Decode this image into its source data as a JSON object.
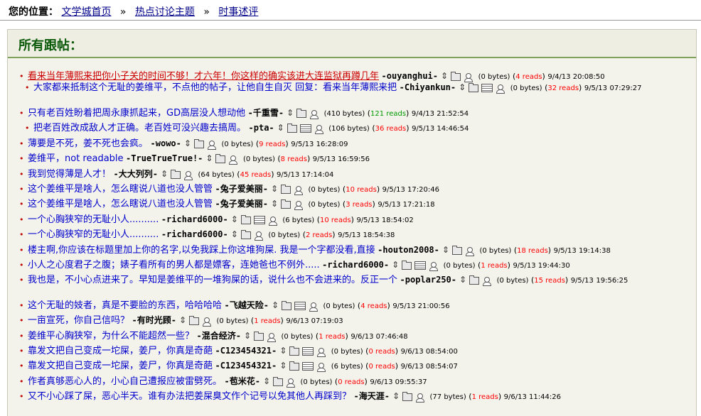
{
  "breadcrumb": {
    "label": "您的位置：",
    "links": [
      "文学城首页",
      "热点讨论主题",
      "时事述评"
    ],
    "sep": "»"
  },
  "panel": {
    "title": "所有跟帖："
  },
  "posts": [
    {
      "indent": 0,
      "title": "看来当年薄熙来把你小子关的时间不够！才六年！你这样的确实该进大连监狱再蹲几年",
      "author": "-ouyanghui-",
      "doc": false,
      "size": "(0 bytes)",
      "reads": "4 reads",
      "readsColor": "#ff0000",
      "date": "9/4/13 20:08:50",
      "red": true
    },
    {
      "indent": 1,
      "title": "大家都来抵制这个无耻的姜维平，不点他的帖子，让他自生自灭 回复：看来当年薄熙来把",
      "author": "-Chiyankun-",
      "doc": true,
      "size": "(0 bytes)",
      "reads": "32 reads",
      "readsColor": "#ff0000",
      "date": "9/5/13",
      "date2": "07:29:27",
      "red": false
    },
    {
      "indent": 0,
      "title": "只有老百姓盼着把周永康抓起来，GD高层没人想动他",
      "author": "-千重雪-",
      "doc": false,
      "size": "(410 bytes)",
      "reads": "121 reads",
      "readsColor": "#009900",
      "date": "9/4/13 21:52:54",
      "red": false
    },
    {
      "indent": 1,
      "title": "把老百姓改成敌人才正确。老百姓可没兴趣去搞周。",
      "author": "-pta-",
      "doc": true,
      "size": "(106 bytes)",
      "reads": "36 reads",
      "readsColor": "#ff0000",
      "date": "9/5/13 14:46:54",
      "red": false
    },
    {
      "indent": 0,
      "title": "薄要是不死，姜不死也会疯。",
      "author": "-wowo-",
      "doc": false,
      "size": "(0 bytes)",
      "reads": "9 reads",
      "readsColor": "#ff0000",
      "date": "9/5/13 16:28:09",
      "red": false
    },
    {
      "indent": 0,
      "title": "姜维平，not readable",
      "author": "-TrueTrueTrue!-",
      "doc": false,
      "size": "(0 bytes)",
      "reads": "8 reads",
      "readsColor": "#ff0000",
      "date": "9/5/13 16:59:56",
      "red": false
    },
    {
      "indent": 0,
      "title": "我到觉得薄是人才！",
      "author": "-大大列列-",
      "doc": false,
      "size": "(64 bytes)",
      "reads": "45 reads",
      "readsColor": "#ff0000",
      "date": "9/5/13 17:14:04",
      "red": false
    },
    {
      "indent": 0,
      "title": "这个姜维平是啥人，怎么瞎说八道也没人管管",
      "author": "-兔子爱美丽-",
      "doc": false,
      "size": "(0 bytes)",
      "reads": "10 reads",
      "readsColor": "#ff0000",
      "date": "9/5/13 17:20:46",
      "red": false
    },
    {
      "indent": 0,
      "title": "这个姜维平是啥人，怎么瞎说八道也没人管管",
      "author": "-兔子爱美丽-",
      "doc": false,
      "size": "(0 bytes)",
      "reads": "3 reads",
      "readsColor": "#ff0000",
      "date": "9/5/13 17:21:18",
      "red": false
    },
    {
      "indent": 0,
      "title": "一个心胸狭窄的无耻小人..........",
      "author": "-richard6000-",
      "doc": true,
      "size": "(6 bytes)",
      "reads": "10 reads",
      "readsColor": "#ff0000",
      "date": "9/5/13 18:54:02",
      "red": false
    },
    {
      "indent": 0,
      "title": "一个心胸狭窄的无耻小人..........",
      "author": "-richard6000-",
      "doc": false,
      "size": "(0 bytes)",
      "reads": "2 reads",
      "readsColor": "#ff0000",
      "date": "9/5/13 18:54:38",
      "red": false
    },
    {
      "indent": 0,
      "title": "楼主啊,你应该在标题里加上你的名字,以免我踩上你这堆狗屎. 我是一个字都没看,直接",
      "author": "-houton2008-",
      "doc": false,
      "size": "(0 bytes)",
      "reads": "18 reads",
      "readsColor": "#ff0000",
      "date": "9/5/13 19:14:38",
      "red": false
    },
    {
      "indent": 0,
      "title": "小人之心度君子之腹；婊子看所有的男人都是嫖客，连她爸也不例外.....",
      "author": "-richard6000-",
      "doc": true,
      "size": "(0 bytes)",
      "reads": "1 reads",
      "readsColor": "#ff0000",
      "date": "9/5/13 19:44:30",
      "red": false
    },
    {
      "indent": 0,
      "title": "我也是，不小心点进来了。早知是姜维平的一堆狗屎的话，说什么也不会进来的。反正一个",
      "author": "-poplar250-",
      "doc": false,
      "size": "(0 bytes)",
      "reads": "15 reads",
      "readsColor": "#ff0000",
      "date": "9/5/13",
      "date2": "19:56:25",
      "red": false
    },
    {
      "indent": 0,
      "title": "这个无耻的妓者，真是不要脸的东西，哈哈哈哈",
      "author": "-飞越天险-",
      "doc": true,
      "size": "(0 bytes)",
      "reads": "4 reads",
      "readsColor": "#ff0000",
      "date": "9/5/13 21:00:56",
      "red": false
    },
    {
      "indent": 0,
      "title": "一亩宣死，你自己信吗？",
      "author": "-有时光顾-",
      "doc": false,
      "size": "(0 bytes)",
      "reads": "1 reads",
      "readsColor": "#ff0000",
      "date": "9/6/13 07:19:03",
      "red": false
    },
    {
      "indent": 0,
      "title": "姜维平心胸狭窄，为什么不能超然一些？",
      "author": "-混合经济-",
      "doc": false,
      "size": "(0 bytes)",
      "reads": "1 reads",
      "readsColor": "#ff0000",
      "date": "9/6/13 07:46:48",
      "red": false
    },
    {
      "indent": 0,
      "title": "靠发文把自己变成一坨屎，姜尸，你真是奇葩",
      "author": "-C123454321-",
      "doc": true,
      "size": "(0 bytes)",
      "reads": "0 reads",
      "readsColor": "#ff0000",
      "date": "9/6/13 08:54:00",
      "red": false
    },
    {
      "indent": 0,
      "title": "靠发文把自己变成一坨屎，姜尸，你真是奇葩",
      "author": "-C123454321-",
      "doc": true,
      "size": "(6 bytes)",
      "reads": "0 reads",
      "readsColor": "#ff0000",
      "date": "9/6/13 08:54:07",
      "red": false
    },
    {
      "indent": 0,
      "title": "作者真够恶心人的，小心自己遭报应被雷劈死。",
      "author": "-苞米花-",
      "doc": false,
      "size": "(0 bytes)",
      "reads": "0 reads",
      "readsColor": "#ff0000",
      "date": "9/6/13 09:55:37",
      "red": false
    },
    {
      "indent": 0,
      "title": "又不小心踩了屎，恶心半天。谁有办法把姜屎臭文作个记号以免其他人再踩到？",
      "author": "-海天涯-",
      "doc": false,
      "size": "(77 bytes)",
      "reads": "1 reads",
      "readsColor": "#ff0000",
      "date": "9/6/13 11:44:26",
      "red": false
    }
  ]
}
